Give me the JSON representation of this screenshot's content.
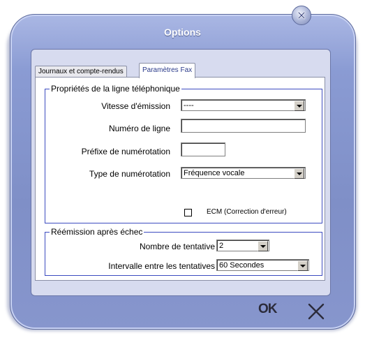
{
  "window": {
    "title": "Options",
    "close_icon": "close-icon"
  },
  "tabs": [
    {
      "label": "Journaux et compte-rendus",
      "active": false
    },
    {
      "label": "Paramètres Fax",
      "active": true
    }
  ],
  "line_props": {
    "legend": "Propriétés de la ligne téléphonique",
    "speed": {
      "label": "Vitesse d'émission",
      "value": "----"
    },
    "line_number": {
      "label": "Numéro de ligne",
      "value": ""
    },
    "prefix": {
      "label": "Préfixe de numérotation",
      "value": ""
    },
    "dial_type": {
      "label": "Type de numérotation",
      "value": "Fréquence vocale"
    },
    "ecm": {
      "label": "ECM (Correction d'erreur)",
      "checked": false
    }
  },
  "retry": {
    "legend": "Réémission après échec",
    "attempts": {
      "label": "Nombre de tentative",
      "value": "2"
    },
    "interval": {
      "label": "Intervalle entre les tentatives",
      "value": "60 Secondes"
    }
  },
  "footer": {
    "ok_label": "OK",
    "cancel_icon": "x-icon"
  },
  "colors": {
    "frame": "#8a9bd3",
    "panel": "#d7dbef",
    "group_border": "#3c4bc0",
    "active_tab_text": "#2a3a8a"
  }
}
